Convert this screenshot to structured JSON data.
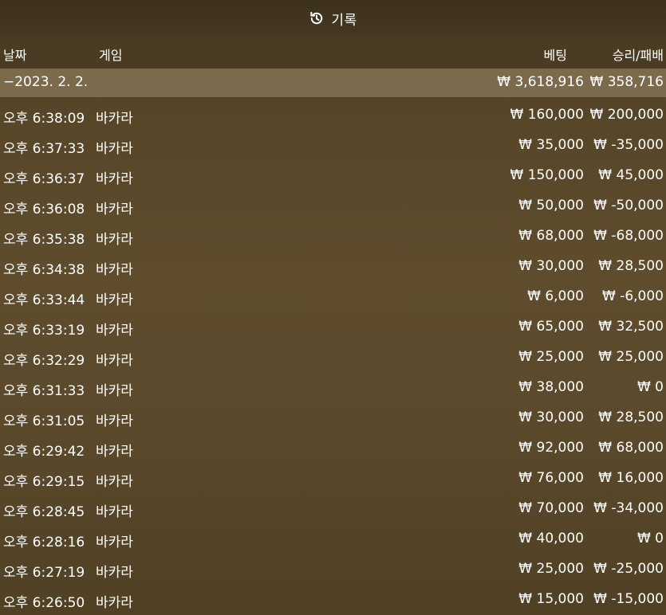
{
  "title": {
    "label": "기록",
    "icon": "history-icon"
  },
  "header": {
    "date": "날짜",
    "game": "게임",
    "bet": "베팅",
    "winloss": "승리/패배"
  },
  "summary": {
    "date": "−2023. 2. 2.",
    "bet": "₩ 3,618,916",
    "winloss": "₩ 358,716"
  },
  "rows": [
    {
      "time": "오후 6:38:09",
      "game": "바카라",
      "bet": "₩ 160,000",
      "winloss": "₩ 200,000"
    },
    {
      "time": "오후 6:37:33",
      "game": "바카라",
      "bet": "₩ 35,000",
      "winloss": "₩ -35,000"
    },
    {
      "time": "오후 6:36:37",
      "game": "바카라",
      "bet": "₩ 150,000",
      "winloss": "₩ 45,000"
    },
    {
      "time": "오후 6:36:08",
      "game": "바카라",
      "bet": "₩ 50,000",
      "winloss": "₩ -50,000"
    },
    {
      "time": "오후 6:35:38",
      "game": "바카라",
      "bet": "₩ 68,000",
      "winloss": "₩ -68,000"
    },
    {
      "time": "오후 6:34:38",
      "game": "바카라",
      "bet": "₩ 30,000",
      "winloss": "₩ 28,500"
    },
    {
      "time": "오후 6:33:44",
      "game": "바카라",
      "bet": "₩ 6,000",
      "winloss": "₩ -6,000"
    },
    {
      "time": "오후 6:33:19",
      "game": "바카라",
      "bet": "₩ 65,000",
      "winloss": "₩ 32,500"
    },
    {
      "time": "오후 6:32:29",
      "game": "바카라",
      "bet": "₩ 25,000",
      "winloss": "₩ 25,000"
    },
    {
      "time": "오후 6:31:33",
      "game": "바카라",
      "bet": "₩ 38,000",
      "winloss": "₩ 0"
    },
    {
      "time": "오후 6:31:05",
      "game": "바카라",
      "bet": "₩ 30,000",
      "winloss": "₩ 28,500"
    },
    {
      "time": "오후 6:29:42",
      "game": "바카라",
      "bet": "₩ 92,000",
      "winloss": "₩ 68,000"
    },
    {
      "time": "오후 6:29:15",
      "game": "바카라",
      "bet": "₩ 76,000",
      "winloss": "₩ 16,000"
    },
    {
      "time": "오후 6:28:45",
      "game": "바카라",
      "bet": "₩ 70,000",
      "winloss": "₩ -34,000"
    },
    {
      "time": "오후 6:28:16",
      "game": "바카라",
      "bet": "₩ 40,000",
      "winloss": "₩ 0"
    },
    {
      "time": "오후 6:27:19",
      "game": "바카라",
      "bet": "₩ 25,000",
      "winloss": "₩ -25,000"
    },
    {
      "time": "오후 6:26:50",
      "game": "바카라",
      "bet": "₩ 15,000",
      "winloss": "₩ -15,000"
    }
  ]
}
